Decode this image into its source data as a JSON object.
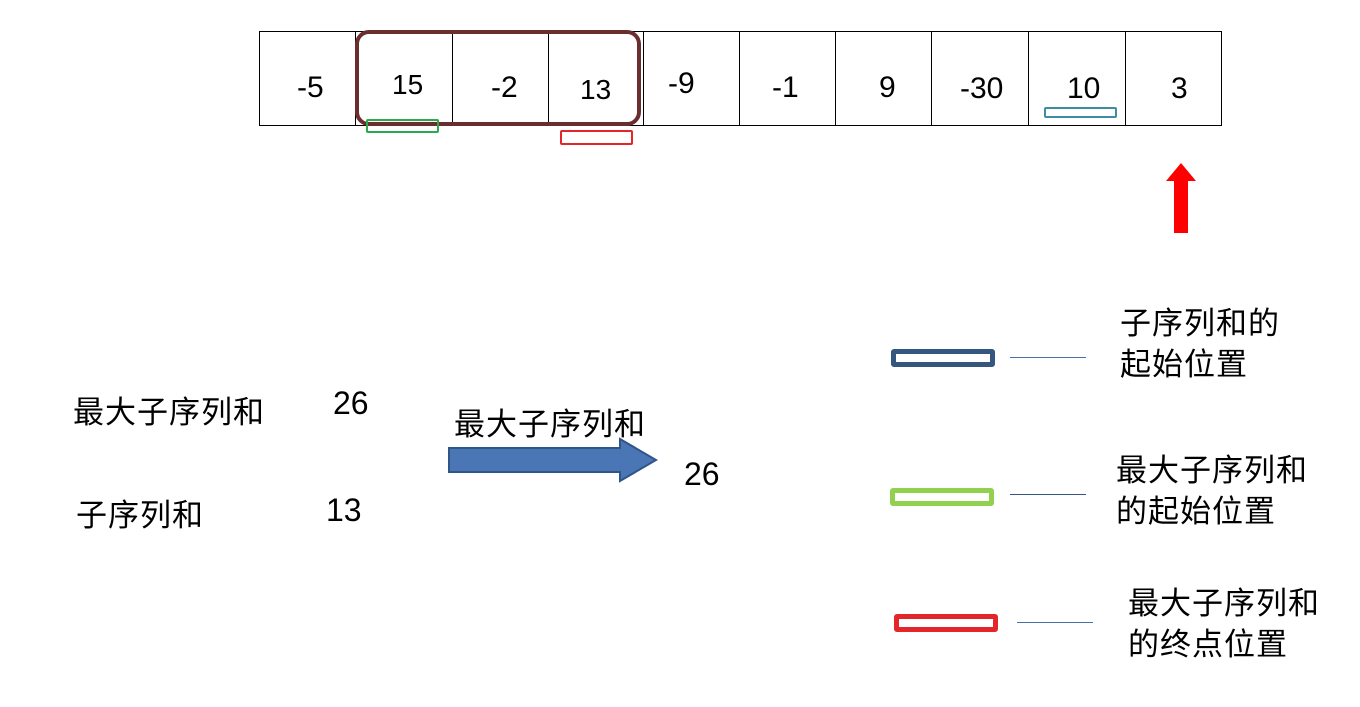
{
  "array": {
    "cells": [
      "-5",
      "15",
      "-2",
      "13",
      "-9",
      "-1",
      "9",
      "-30",
      "10",
      "3"
    ]
  },
  "summary": {
    "max_label": "最大子序列和",
    "max_value": "26",
    "current_label": "子序列和",
    "current_value": "13"
  },
  "transition": {
    "arrow_label": "最大子序列和",
    "result_value": "26"
  },
  "legend": {
    "items": [
      {
        "line1": "子序列和的",
        "line2": "起始位置",
        "color": "#34567f"
      },
      {
        "line1": "最大子序列和",
        "line2": "的起始位置",
        "color": "#92d050"
      },
      {
        "line1": "最大子序列和",
        "line2": "的终点位置",
        "color": "#e3262a"
      }
    ]
  },
  "colors": {
    "window_border": "#6b2e2e",
    "scan_arrow": "#ff0000",
    "flow_arrow": "#4a76b5",
    "green_marker": "#2ea84a",
    "red_marker": "#e3262a",
    "teal_marker": "#3c8fa0"
  }
}
